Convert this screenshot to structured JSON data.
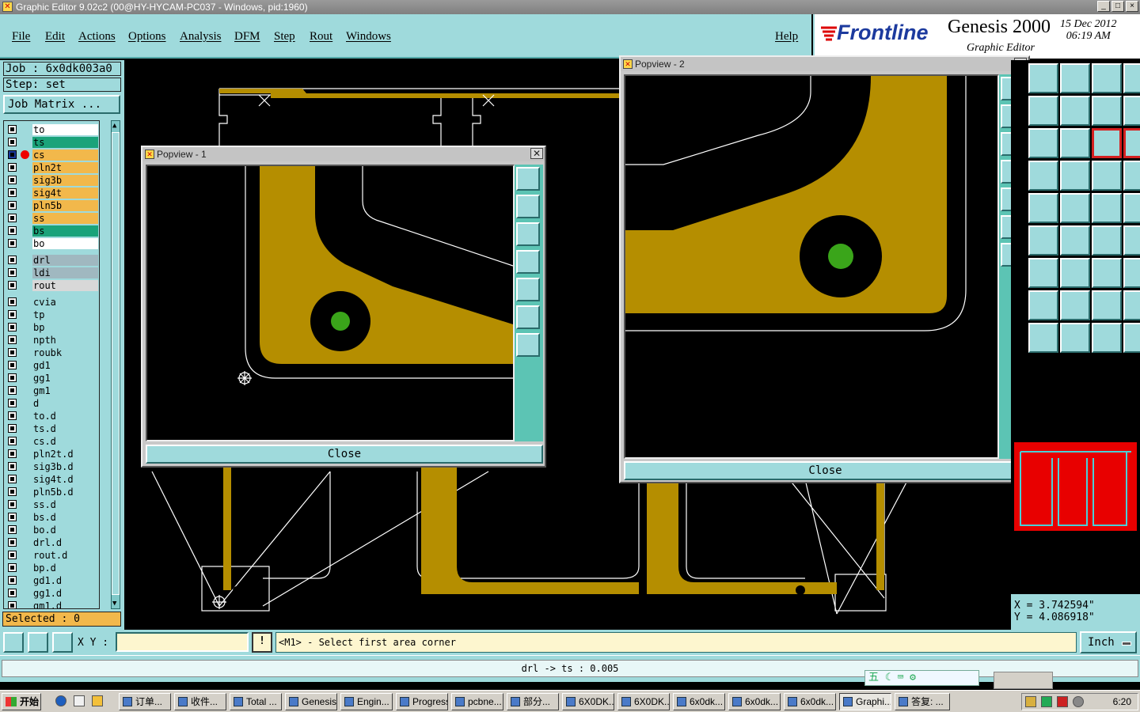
{
  "window": {
    "title": "Graphic Editor 9.02c2 (00@HY-HYCAM-PC037 - Windows, pid:1960)",
    "controls": [
      "_",
      "□",
      "×"
    ]
  },
  "menu": [
    "File",
    "Edit",
    "Actions",
    "Options",
    "Analysis",
    "DFM",
    "Step",
    "Rout",
    "Windows"
  ],
  "help": "Help",
  "brand": {
    "logo": "Frontline",
    "product": "Genesis 2000",
    "subtitle": "Graphic Editor",
    "date": "15 Dec 2012",
    "time": "06:19 AM"
  },
  "left": {
    "job": "Job : 6x0dk003a0",
    "step": "Step: set",
    "job_matrix": "Job Matrix ...",
    "selected": "Selected : 0",
    "layers": [
      {
        "name": "to",
        "color": "#ffffff"
      },
      {
        "name": "ts",
        "color": "#1aa37a"
      },
      {
        "name": "cs",
        "color": "#f2b84b",
        "work": true
      },
      {
        "name": "pln2t",
        "color": "#f2b84b"
      },
      {
        "name": "sig3b",
        "color": "#f2b84b"
      },
      {
        "name": "sig4t",
        "color": "#f2b84b"
      },
      {
        "name": "pln5b",
        "color": "#f2b84b"
      },
      {
        "name": "ss",
        "color": "#f2b84b"
      },
      {
        "name": "bs",
        "color": "#1aa37a"
      },
      {
        "name": "bo",
        "color": "#ffffff"
      },
      {
        "name": "drl",
        "color": "#a0b8c0",
        "gap": 1
      },
      {
        "name": "ldi",
        "color": "#a0b8c0"
      },
      {
        "name": "rout",
        "color": "#d8d8d8"
      },
      {
        "name": "cvia",
        "color": "#9fdadc",
        "gap": 1
      },
      {
        "name": "tp",
        "color": "#9fdadc"
      },
      {
        "name": "bp",
        "color": "#9fdadc"
      },
      {
        "name": "npth",
        "color": "#9fdadc"
      },
      {
        "name": "roubk",
        "color": "#9fdadc"
      },
      {
        "name": "gd1",
        "color": "#9fdadc"
      },
      {
        "name": "gg1",
        "color": "#9fdadc"
      },
      {
        "name": "gm1",
        "color": "#9fdadc"
      },
      {
        "name": "d",
        "color": "#9fdadc"
      },
      {
        "name": "to.d",
        "color": "#9fdadc"
      },
      {
        "name": "ts.d",
        "color": "#9fdadc"
      },
      {
        "name": "cs.d",
        "color": "#9fdadc"
      },
      {
        "name": "pln2t.d",
        "color": "#9fdadc"
      },
      {
        "name": "sig3b.d",
        "color": "#9fdadc"
      },
      {
        "name": "sig4t.d",
        "color": "#9fdadc"
      },
      {
        "name": "pln5b.d",
        "color": "#9fdadc"
      },
      {
        "name": "ss.d",
        "color": "#9fdadc"
      },
      {
        "name": "bs.d",
        "color": "#9fdadc"
      },
      {
        "name": "bo.d",
        "color": "#9fdadc"
      },
      {
        "name": "drl.d",
        "color": "#9fdadc"
      },
      {
        "name": "rout.d",
        "color": "#9fdadc"
      },
      {
        "name": "bp.d",
        "color": "#9fdadc"
      },
      {
        "name": "gd1.d",
        "color": "#9fdadc"
      },
      {
        "name": "gg1.d",
        "color": "#9fdadc"
      },
      {
        "name": "gm1.d",
        "color": "#9fdadc"
      }
    ]
  },
  "popview1": {
    "title": "Popview - 1",
    "close_label": "Close"
  },
  "popview2": {
    "title": "Popview - 2",
    "close_label": "Close"
  },
  "coords": {
    "x": "X = 3.742594\"",
    "y": "Y = 4.086918\""
  },
  "command": {
    "xy_label": "X Y :",
    "xy_value": "",
    "info_icon": "!",
    "prompt": "<M1> - Select first area corner",
    "unit": "Inch"
  },
  "status": "drl -> ts : 0.005",
  "ime": "五 ☾ ⌨ ⚙",
  "taskbar": {
    "start": "开始",
    "items": [
      "订单...",
      "收件...",
      "Total ...",
      "Genesis",
      "Engin...",
      "Progress",
      "pcbne...",
      "部分...",
      "6X0DK...",
      "6X0DK...",
      "6x0dk...",
      "6x0dk...",
      "6x0dk...",
      "Graphi...",
      "答复: ..."
    ],
    "clock": "6:20"
  },
  "colors": {
    "panel": "#9fdadc",
    "copper": "#b58e00",
    "pad": "#3aa51a",
    "outline": "#ffffff"
  }
}
